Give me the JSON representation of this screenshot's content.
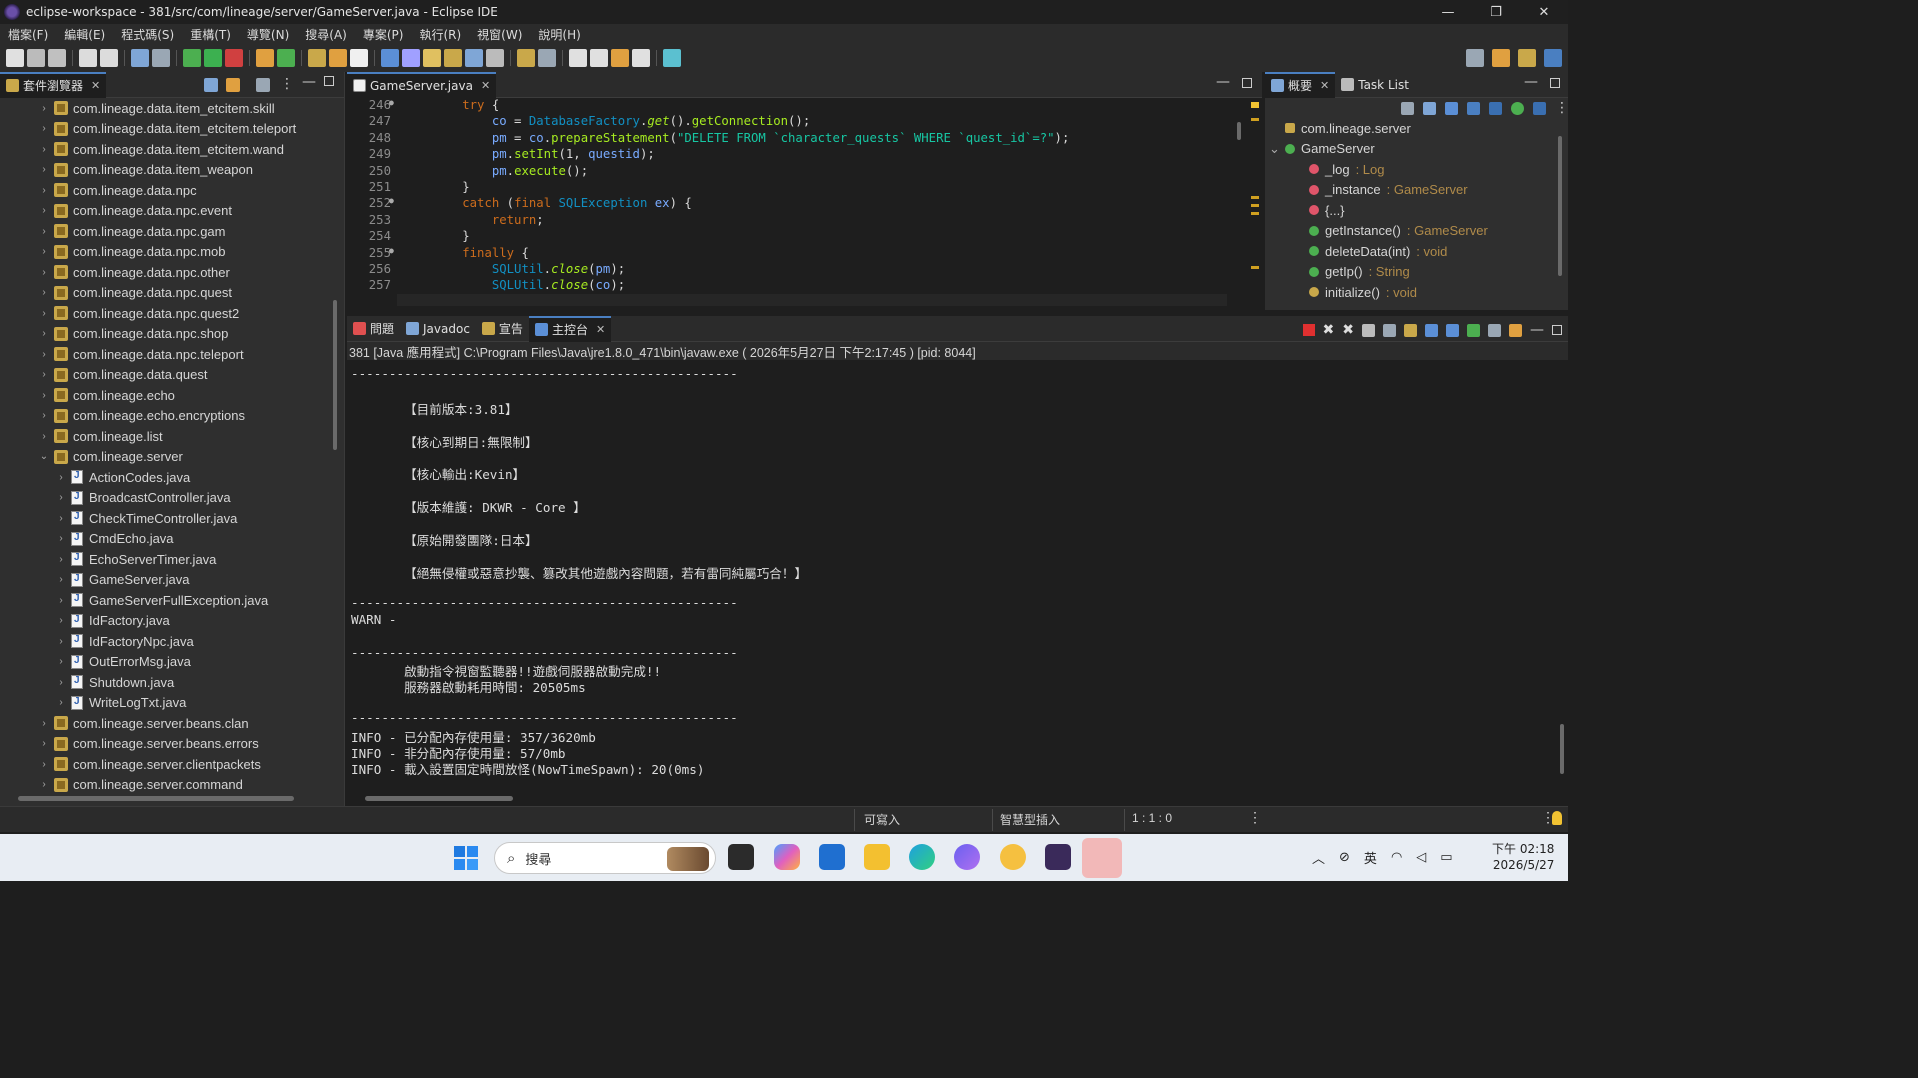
{
  "window": {
    "title": "eclipse-workspace - 381/src/com/lineage/server/GameServer.java - Eclipse IDE",
    "minimize": "—",
    "restore": "❐",
    "close": "✕"
  },
  "menu": [
    "檔案(F)",
    "編輯(E)",
    "程式碼(S)",
    "重構(T)",
    "導覽(N)",
    "搜尋(A)",
    "專案(P)",
    "執行(R)",
    "視窗(W)",
    "說明(H)"
  ],
  "package_explorer": {
    "tab_label": "套件瀏覽器",
    "items": [
      {
        "label": "com.lineage.data.item_etcitem.skill",
        "kind": "package",
        "indent": 0,
        "expanded": false
      },
      {
        "label": "com.lineage.data.item_etcitem.teleport",
        "kind": "package",
        "indent": 0,
        "expanded": false
      },
      {
        "label": "com.lineage.data.item_etcitem.wand",
        "kind": "package",
        "indent": 0,
        "expanded": false
      },
      {
        "label": "com.lineage.data.item_weapon",
        "kind": "package",
        "indent": 0,
        "expanded": false
      },
      {
        "label": "com.lineage.data.npc",
        "kind": "package",
        "indent": 0,
        "expanded": false
      },
      {
        "label": "com.lineage.data.npc.event",
        "kind": "package",
        "indent": 0,
        "expanded": false
      },
      {
        "label": "com.lineage.data.npc.gam",
        "kind": "package",
        "indent": 0,
        "expanded": false
      },
      {
        "label": "com.lineage.data.npc.mob",
        "kind": "package",
        "indent": 0,
        "expanded": false
      },
      {
        "label": "com.lineage.data.npc.other",
        "kind": "package",
        "indent": 0,
        "expanded": false
      },
      {
        "label": "com.lineage.data.npc.quest",
        "kind": "package",
        "indent": 0,
        "expanded": false
      },
      {
        "label": "com.lineage.data.npc.quest2",
        "kind": "package",
        "indent": 0,
        "expanded": false
      },
      {
        "label": "com.lineage.data.npc.shop",
        "kind": "package",
        "indent": 0,
        "expanded": false
      },
      {
        "label": "com.lineage.data.npc.teleport",
        "kind": "package",
        "indent": 0,
        "expanded": false
      },
      {
        "label": "com.lineage.data.quest",
        "kind": "package",
        "indent": 0,
        "expanded": false
      },
      {
        "label": "com.lineage.echo",
        "kind": "package",
        "indent": 0,
        "expanded": false
      },
      {
        "label": "com.lineage.echo.encryptions",
        "kind": "package",
        "indent": 0,
        "expanded": false
      },
      {
        "label": "com.lineage.list",
        "kind": "package",
        "indent": 0,
        "expanded": false
      },
      {
        "label": "com.lineage.server",
        "kind": "package",
        "indent": 0,
        "expanded": true
      },
      {
        "label": "ActionCodes.java",
        "kind": "java",
        "indent": 1,
        "expanded": false
      },
      {
        "label": "BroadcastController.java",
        "kind": "java",
        "indent": 1,
        "expanded": false
      },
      {
        "label": "CheckTimeController.java",
        "kind": "java",
        "indent": 1,
        "expanded": false
      },
      {
        "label": "CmdEcho.java",
        "kind": "java",
        "indent": 1,
        "expanded": false
      },
      {
        "label": "EchoServerTimer.java",
        "kind": "java",
        "indent": 1,
        "expanded": false
      },
      {
        "label": "GameServer.java",
        "kind": "java",
        "indent": 1,
        "expanded": false
      },
      {
        "label": "GameServerFullException.java",
        "kind": "java",
        "indent": 1,
        "expanded": false
      },
      {
        "label": "IdFactory.java",
        "kind": "java",
        "indent": 1,
        "expanded": false
      },
      {
        "label": "IdFactoryNpc.java",
        "kind": "java",
        "indent": 1,
        "expanded": false
      },
      {
        "label": "OutErrorMsg.java",
        "kind": "java",
        "indent": 1,
        "expanded": false
      },
      {
        "label": "Shutdown.java",
        "kind": "java",
        "indent": 1,
        "expanded": false
      },
      {
        "label": "WriteLogTxt.java",
        "kind": "java",
        "indent": 1,
        "expanded": false
      },
      {
        "label": "com.lineage.server.beans.clan",
        "kind": "package",
        "indent": 0,
        "expanded": false
      },
      {
        "label": "com.lineage.server.beans.errors",
        "kind": "package",
        "indent": 0,
        "expanded": false
      },
      {
        "label": "com.lineage.server.clientpackets",
        "kind": "package",
        "indent": 0,
        "expanded": false
      },
      {
        "label": "com.lineage.server.command",
        "kind": "package",
        "indent": 0,
        "expanded": false
      }
    ]
  },
  "editor": {
    "tab_label": "GameServer.java",
    "lines": [
      {
        "num": "246",
        "marker": true,
        "html": "        <span class='kw'>try</span> {"
      },
      {
        "num": "247",
        "marker": false,
        "html": "            <span class='var'>co</span> = <span class='type'>DatabaseFactory</span>.<span class='fn it'>get</span>().<span class='fn'>getConnection</span>();"
      },
      {
        "num": "248",
        "marker": false,
        "html": "            <span class='var'>pm</span> = <span class='var'>co</span>.<span class='fn'>prepareStatement</span>(<span class='str'>\"DELETE FROM `character_quests` WHERE `quest_id`=?\"</span>);"
      },
      {
        "num": "249",
        "marker": false,
        "html": "            <span class='var'>pm</span>.<span class='fn'>setInt</span>(1, <span class='var'>questid</span>);"
      },
      {
        "num": "250",
        "marker": false,
        "html": "            <span class='var'>pm</span>.<span class='fn'>execute</span>();"
      },
      {
        "num": "251",
        "marker": false,
        "html": "        }"
      },
      {
        "num": "252",
        "marker": true,
        "html": "        <span class='kw'>catch</span> (<span class='kw'>final</span> <span class='type'>SQLException</span> <span class='var'>ex</span>) {"
      },
      {
        "num": "253",
        "marker": false,
        "html": "            <span class='kw'>return</span>;"
      },
      {
        "num": "254",
        "marker": false,
        "html": "        }"
      },
      {
        "num": "255",
        "marker": true,
        "html": "        <span class='kw'>finally</span> {"
      },
      {
        "num": "256",
        "marker": false,
        "html": "            <span class='type'>SQLUtil</span>.<span class='fn it'>close</span>(<span class='var'>pm</span>);"
      },
      {
        "num": "257",
        "marker": false,
        "html": "            <span class='type'>SQLUtil</span>.<span class='fn it'>close</span>(<span class='var'>co</span>);"
      }
    ]
  },
  "outline": {
    "tab_label": "概要",
    "tab2_label": "Task List",
    "items": [
      {
        "name": "com.lineage.server",
        "type": "",
        "icon": "package-decl-icon",
        "color": "#c9a84a",
        "indent": 1
      },
      {
        "name": "GameServer",
        "type": "",
        "icon": "class-icon",
        "color": "#4caf50",
        "indent": 1
      },
      {
        "name": "_log",
        "type": ": Log",
        "icon": "field-icon",
        "color": "#e0556a",
        "indent": 3
      },
      {
        "name": "_instance",
        "type": ": GameServer",
        "icon": "field-icon",
        "color": "#e0556a",
        "indent": 3
      },
      {
        "name": "{...}",
        "type": "",
        "icon": "initializer-icon",
        "color": "#e0556a",
        "indent": 3
      },
      {
        "name": "getInstance()",
        "type": ": GameServer",
        "icon": "method-public-icon",
        "color": "#4caf50",
        "indent": 3
      },
      {
        "name": "deleteData(int)",
        "type": ": void",
        "icon": "method-public-icon",
        "color": "#4caf50",
        "indent": 3
      },
      {
        "name": "getIp()",
        "type": ": String",
        "icon": "method-public-icon",
        "color": "#4caf50",
        "indent": 3
      },
      {
        "name": "initialize()",
        "type": ": void",
        "icon": "method-public-icon",
        "color": "#c9a84a",
        "indent": 3
      }
    ]
  },
  "bottom_tabs": [
    {
      "label": "問題",
      "icon": "problems-icon",
      "active": false
    },
    {
      "label": "Javadoc",
      "icon": "javadoc-icon",
      "active": false
    },
    {
      "label": "宣告",
      "icon": "declaration-icon",
      "active": false
    },
    {
      "label": "主控台",
      "icon": "console-icon",
      "active": true
    }
  ],
  "console": {
    "header": "381 [Java 應用程式] C:\\Program Files\\Java\\jre1.8.0_471\\bin\\javaw.exe  ( 2026年5月27日 下午2:17:45 )  [pid: 8044]",
    "lines": [
      "---------------------------------------------------",
      "",
      "       【目前版本:3.81】",
      "",
      "       【核心到期日:無限制】",
      "",
      "       【核心輸出:Kevin】",
      "",
      "       【版本維護: DKWR - Core 】",
      "",
      "       【原始開發團隊:日本】",
      "",
      "       【絕無侵權或惡意抄襲、篡改其他遊戲內容問題，若有雷同純屬巧合！】",
      "",
      "---------------------------------------------------",
      "WARN -",
      "",
      "---------------------------------------------------",
      "       啟動指令視窗監聽器!!遊戲伺服器啟動完成!!",
      "       服務器啟動耗用時間: 20505ms",
      "",
      "---------------------------------------------------",
      "INFO - 已分配內存使用量: 357/3620mb",
      "INFO - 非分配內存使用量: 57/0mb",
      "INFO - 載入設置固定時間放怪(NowTimeSpawn): 20(0ms)"
    ]
  },
  "status": {
    "writable": "可寫入",
    "insert_mode": "智慧型插入",
    "position": "1 : 1 : 0"
  },
  "taskbar": {
    "search_placeholder": "搜尋",
    "ime": "英",
    "time": "下午 02:18",
    "date": "2026/5/27"
  }
}
